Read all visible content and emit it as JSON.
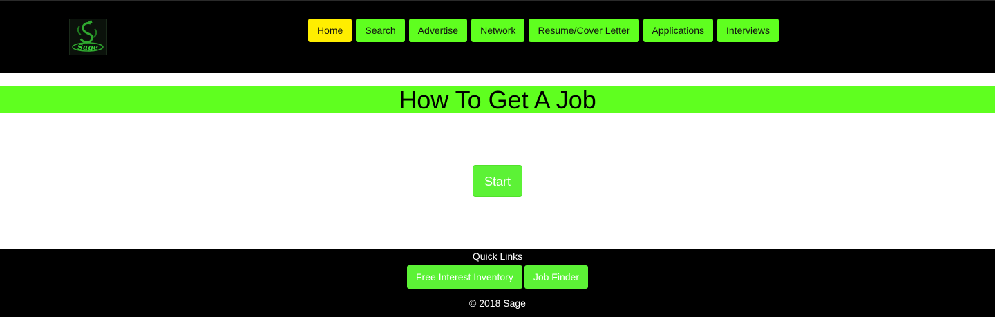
{
  "header": {
    "logo": {
      "icon": "sage-dragon-logo-icon",
      "text": "Sage"
    },
    "nav": [
      {
        "label": "Home",
        "active": true
      },
      {
        "label": "Search",
        "active": false
      },
      {
        "label": "Advertise",
        "active": false
      },
      {
        "label": "Network",
        "active": false
      },
      {
        "label": "Resume/Cover Letter",
        "active": false
      },
      {
        "label": "Applications",
        "active": false
      },
      {
        "label": "Interviews",
        "active": false
      }
    ]
  },
  "main": {
    "title": "How To Get A Job",
    "start_label": "Start"
  },
  "footer": {
    "title": "Quick Links",
    "links": [
      {
        "label": "Free Interest Inventory"
      },
      {
        "label": "Job Finder"
      }
    ],
    "copyright": "© 2018 Sage"
  },
  "colors": {
    "accent": "#5fff1f",
    "active_nav": "#ffee00",
    "background_dark": "#000000"
  }
}
